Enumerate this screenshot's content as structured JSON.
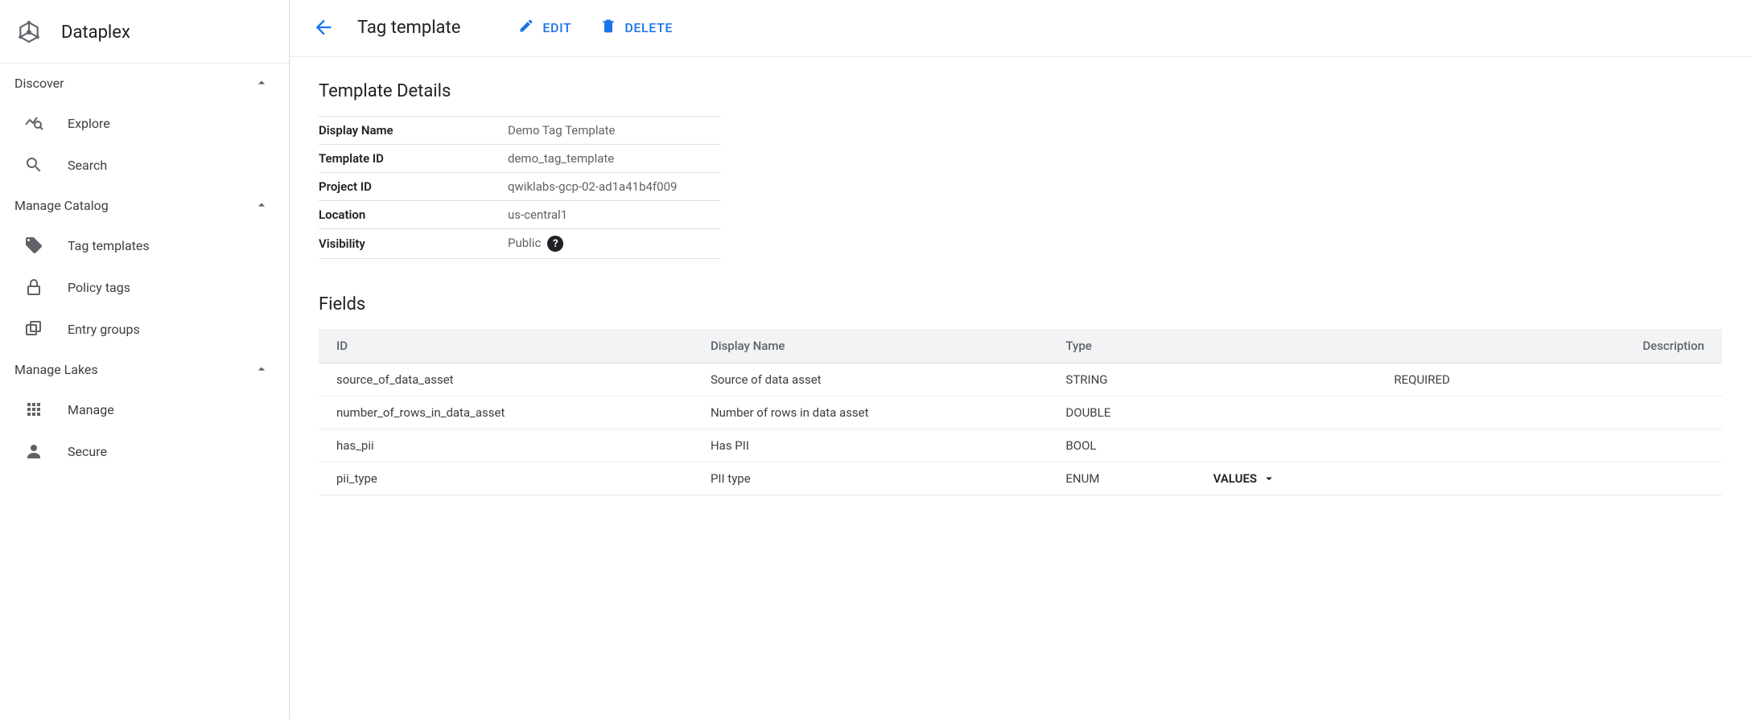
{
  "brand": {
    "name": "Dataplex"
  },
  "sidebar": {
    "sections": [
      {
        "label": "Discover",
        "items": [
          {
            "label": "Explore"
          },
          {
            "label": "Search"
          }
        ]
      },
      {
        "label": "Manage Catalog",
        "items": [
          {
            "label": "Tag templates"
          },
          {
            "label": "Policy tags"
          },
          {
            "label": "Entry groups"
          }
        ]
      },
      {
        "label": "Manage Lakes",
        "items": [
          {
            "label": "Manage"
          },
          {
            "label": "Secure"
          }
        ]
      }
    ]
  },
  "topbar": {
    "title": "Tag template",
    "edit": "EDIT",
    "delete": "DELETE"
  },
  "details": {
    "heading": "Template Details",
    "rows": [
      {
        "label": "Display Name",
        "value": "Demo Tag Template"
      },
      {
        "label": "Template ID",
        "value": "demo_tag_template"
      },
      {
        "label": "Project ID",
        "value": "qwiklabs-gcp-02-ad1a41b4f009"
      },
      {
        "label": "Location",
        "value": "us-central1"
      },
      {
        "label": "Visibility",
        "value": "Public",
        "help": true
      }
    ]
  },
  "fields": {
    "heading": "Fields",
    "columns": [
      "ID",
      "Display Name",
      "Type",
      "",
      "",
      "Description"
    ],
    "values_label": "VALUES",
    "required_label": "REQUIRED",
    "rows": [
      {
        "id": "source_of_data_asset",
        "display": "Source of data asset",
        "type": "STRING",
        "required": true
      },
      {
        "id": "number_of_rows_in_data_asset",
        "display": "Number of rows in data asset",
        "type": "DOUBLE"
      },
      {
        "id": "has_pii",
        "display": "Has PII",
        "type": "BOOL"
      },
      {
        "id": "pii_type",
        "display": "PII type",
        "type": "ENUM",
        "values": true
      }
    ]
  }
}
